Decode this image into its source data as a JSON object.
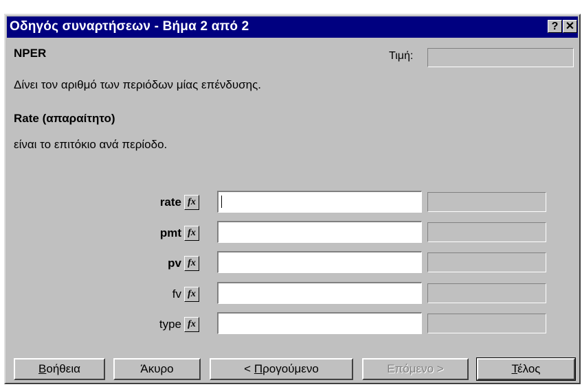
{
  "window": {
    "title": "Οδηγός συναρτήσεων - Βήμα 2 από 2",
    "help_glyph": "?",
    "close_glyph": "✕"
  },
  "function": {
    "name": "NPER",
    "value_label": "Τιμή:",
    "value": "",
    "description": "Δίνει τον αριθμό των περιόδων μίας επένδυσης."
  },
  "argument_help": {
    "title": "Rate (απαραίτητο)",
    "description": "είναι το επιτόκιο ανά περίοδο."
  },
  "arguments": [
    {
      "name": "rate",
      "bold": true,
      "input": "",
      "result": ""
    },
    {
      "name": "pmt",
      "bold": true,
      "input": "",
      "result": ""
    },
    {
      "name": "pv",
      "bold": true,
      "input": "",
      "result": ""
    },
    {
      "name": "fv",
      "bold": false,
      "input": "",
      "result": ""
    },
    {
      "name": "type",
      "bold": false,
      "input": "",
      "result": ""
    }
  ],
  "fx_label": "fx",
  "buttons": {
    "help": {
      "ul": "Β",
      "rest": "οήθεια"
    },
    "cancel": "Άκυρο",
    "back": {
      "pre": "< ",
      "ul": "Π",
      "rest": "ρογούμενο"
    },
    "next": "Επόμενο >",
    "finish": {
      "ul": "Τ",
      "rest": "έλος"
    }
  }
}
